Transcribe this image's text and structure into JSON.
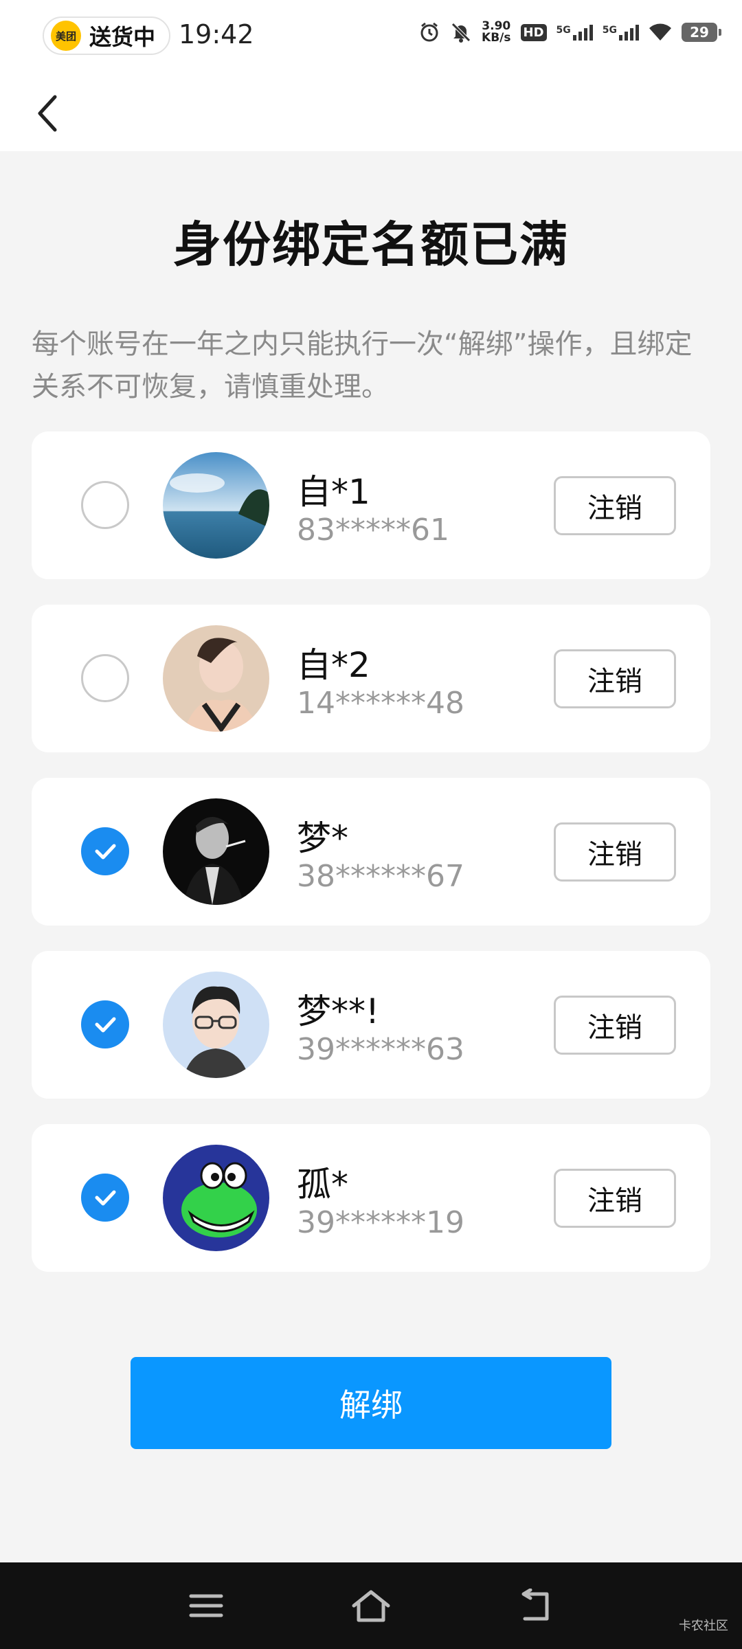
{
  "status_bar": {
    "app_pill_icon": "美团",
    "app_pill_text": "送货中",
    "time": "19:42",
    "net_speed_value": "3.90",
    "net_speed_unit": "KB/s",
    "hd_label": "HD",
    "sim1_label": "5G",
    "sim2_label": "5G",
    "battery": "29",
    "icons": [
      "alarm-icon",
      "mute-icon",
      "signal-icon",
      "wifi-icon",
      "battery-icon"
    ]
  },
  "header": {
    "back_icon": "chevron-left-icon"
  },
  "main": {
    "title": "身份绑定名额已满",
    "description": "每个账号在一年之内只能执行一次“解绑”操作，且绑定关系不可恢复，请慎重处理。"
  },
  "accounts": [
    {
      "name": "自*1",
      "phone": "83*****61",
      "checked": false,
      "cancel_label": "注销"
    },
    {
      "name": "自*2",
      "phone": "14******48",
      "checked": false,
      "cancel_label": "注销"
    },
    {
      "name": "梦*",
      "phone": "38******67",
      "checked": true,
      "cancel_label": "注销"
    },
    {
      "name": "梦**!",
      "phone": "39******63",
      "checked": true,
      "cancel_label": "注销"
    },
    {
      "name": "孤*",
      "phone": "39******19",
      "checked": true,
      "cancel_label": "注销"
    }
  ],
  "unbind_label": "解绑",
  "nav": {
    "icons": [
      "menu-icon",
      "home-icon",
      "back-icon"
    ]
  },
  "watermark": "卡农社区",
  "colors": {
    "accent": "#0a97ff",
    "check": "#1a8cf0",
    "background": "#f4f4f4"
  }
}
